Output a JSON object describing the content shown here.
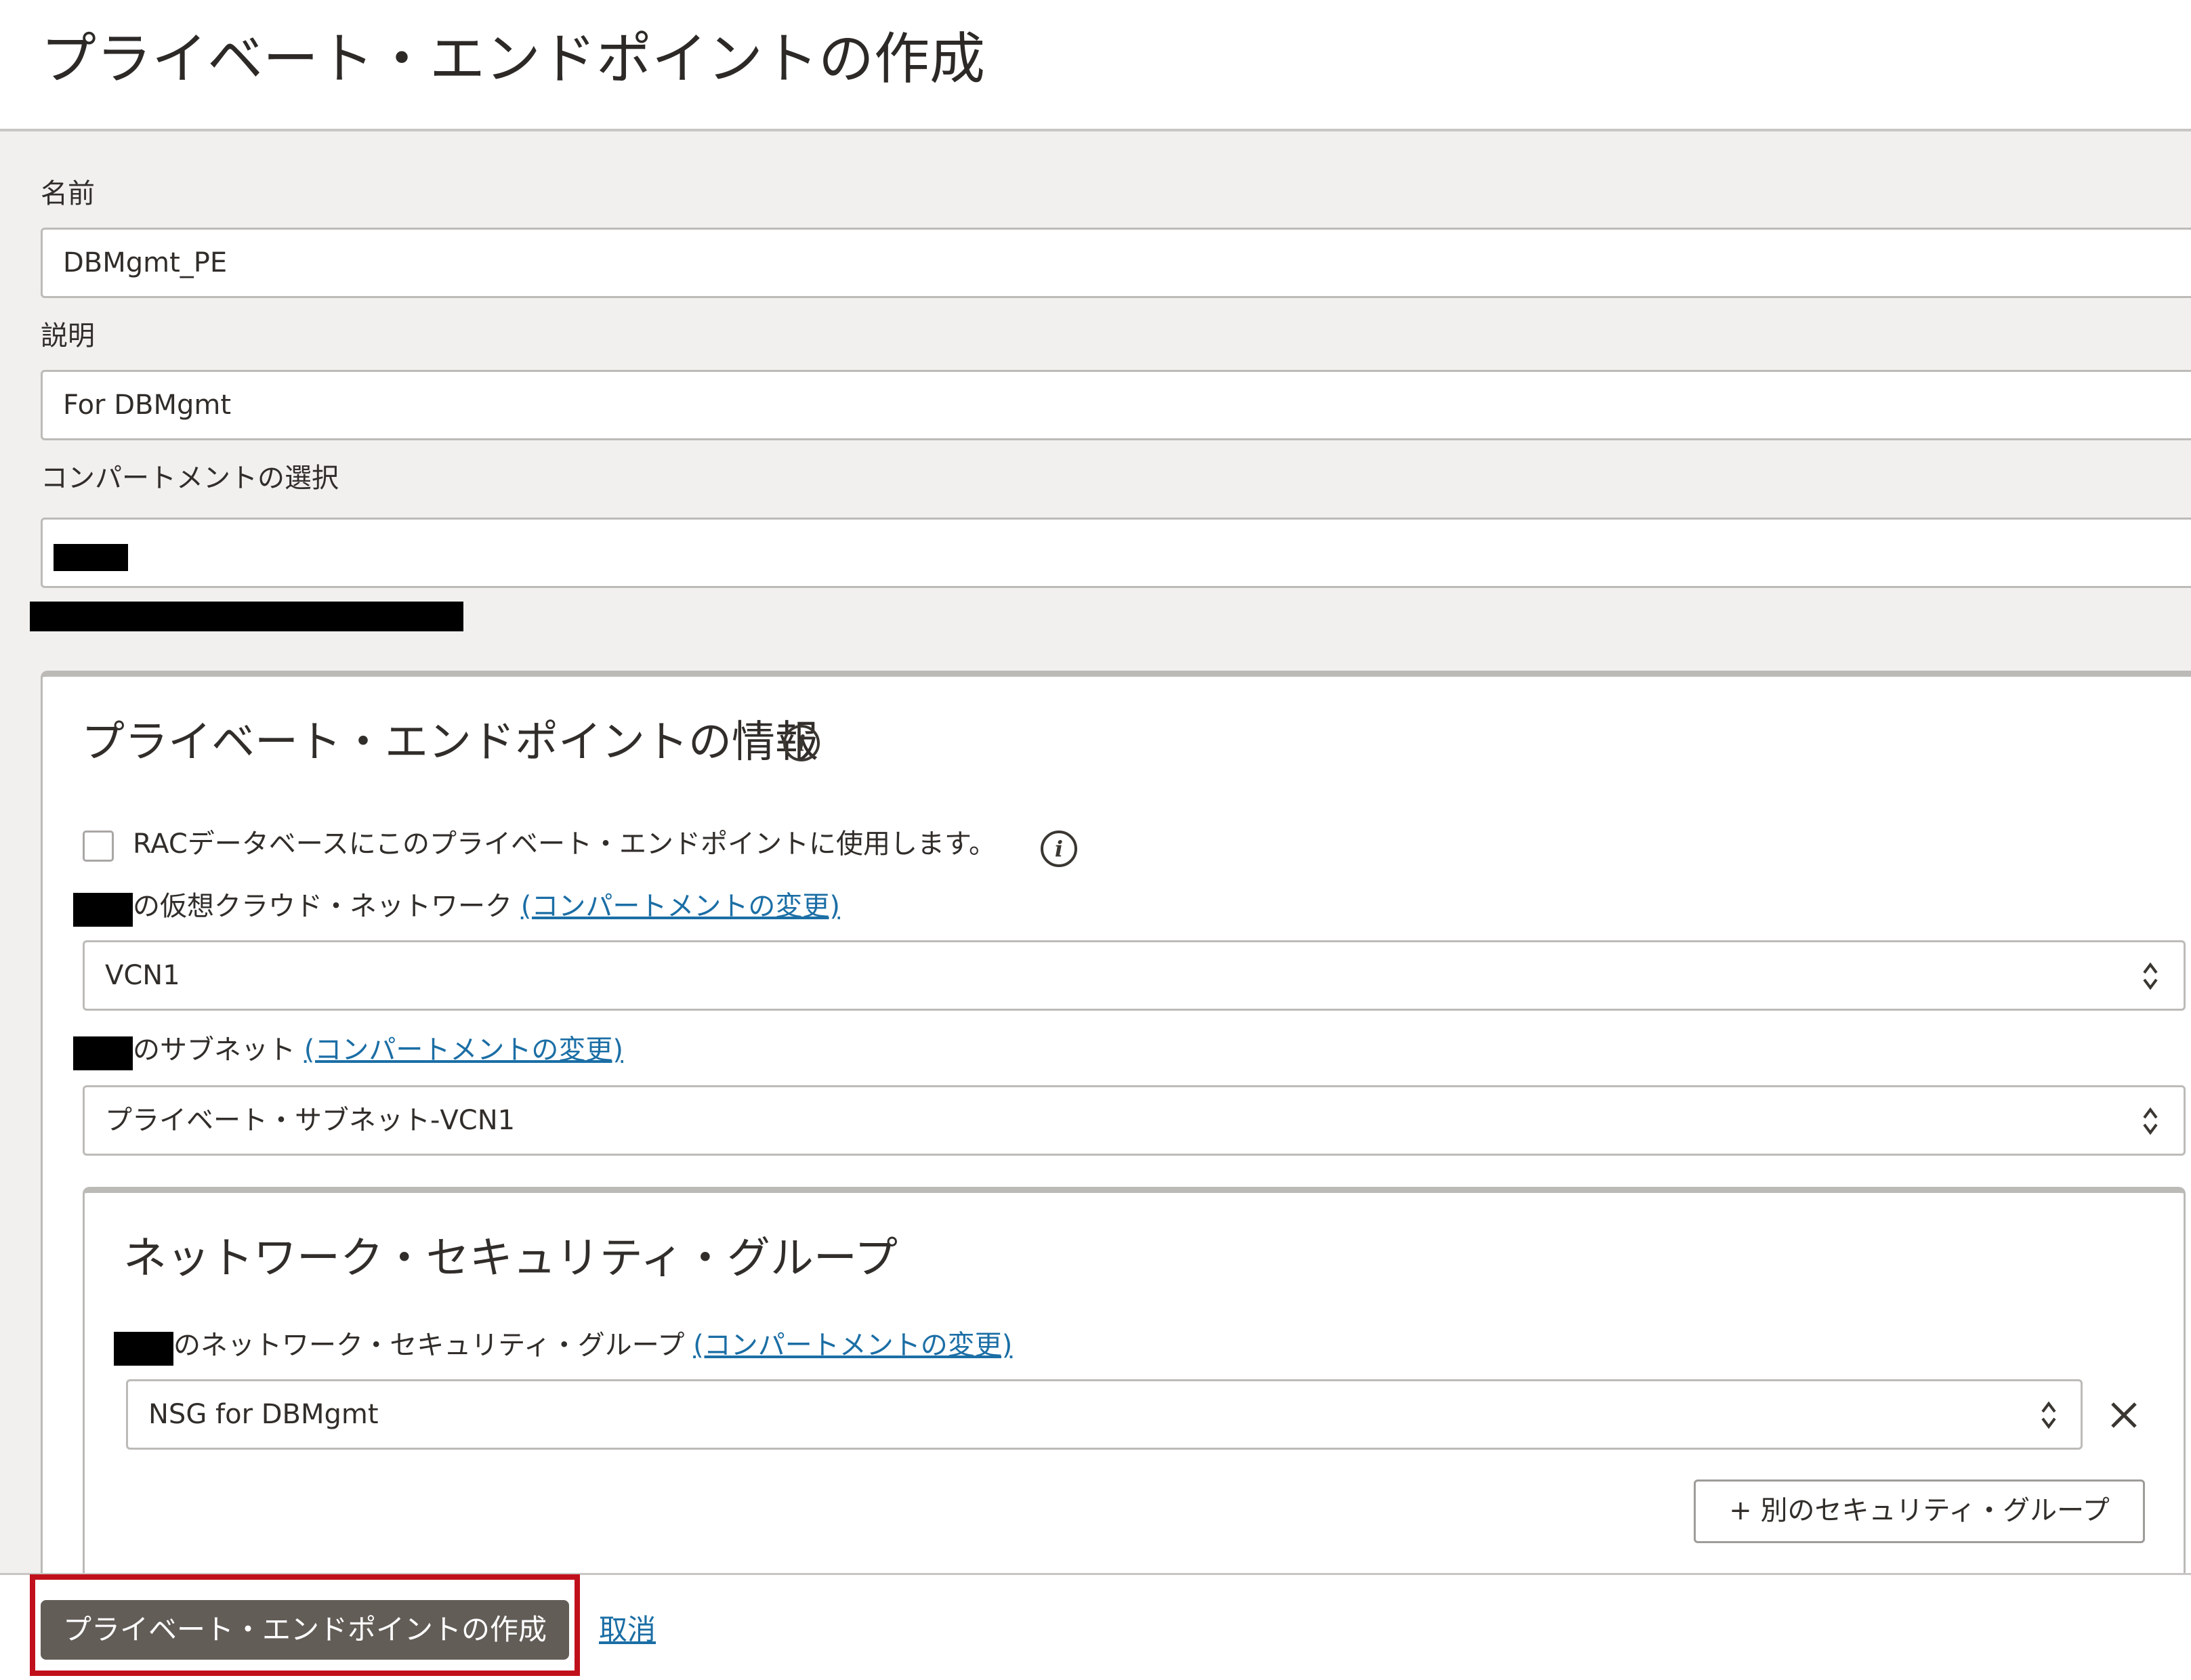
{
  "page": {
    "title": "プライベート・エンドポイントの作成"
  },
  "form": {
    "name_label": "名前",
    "name_value": "DBMgmt_PE",
    "description_label": "説明",
    "description_value": "For DBMgmt",
    "compartment_label": "コンパートメントの選択"
  },
  "endpoint_info": {
    "title": "プライベート・エンドポイントの情報",
    "rac_checkbox_label": "RACデータベースにこのプライベート・エンドポイントに使用します。",
    "rac_checked": false,
    "vcn_label": "の仮想クラウド・ネットワーク",
    "change_compartment_link": "(コンパートメントの変更)",
    "vcn_value": "VCN1",
    "subnet_label": "のサブネット",
    "subnet_value": "プライベート・サブネット-VCN1"
  },
  "nsg": {
    "title": "ネットワーク・セキュリティ・グループ",
    "label": "のネットワーク・セキュリティ・グループ",
    "value": "NSG for DBMgmt",
    "add_button": "+ 別のセキュリティ・グループ"
  },
  "footer": {
    "create_button": "プライベート・エンドポイントの作成",
    "cancel_link": "取消"
  },
  "colors": {
    "primary_button": "#635d58",
    "link": "#1b6ea5",
    "highlight_border": "#c0101b"
  }
}
